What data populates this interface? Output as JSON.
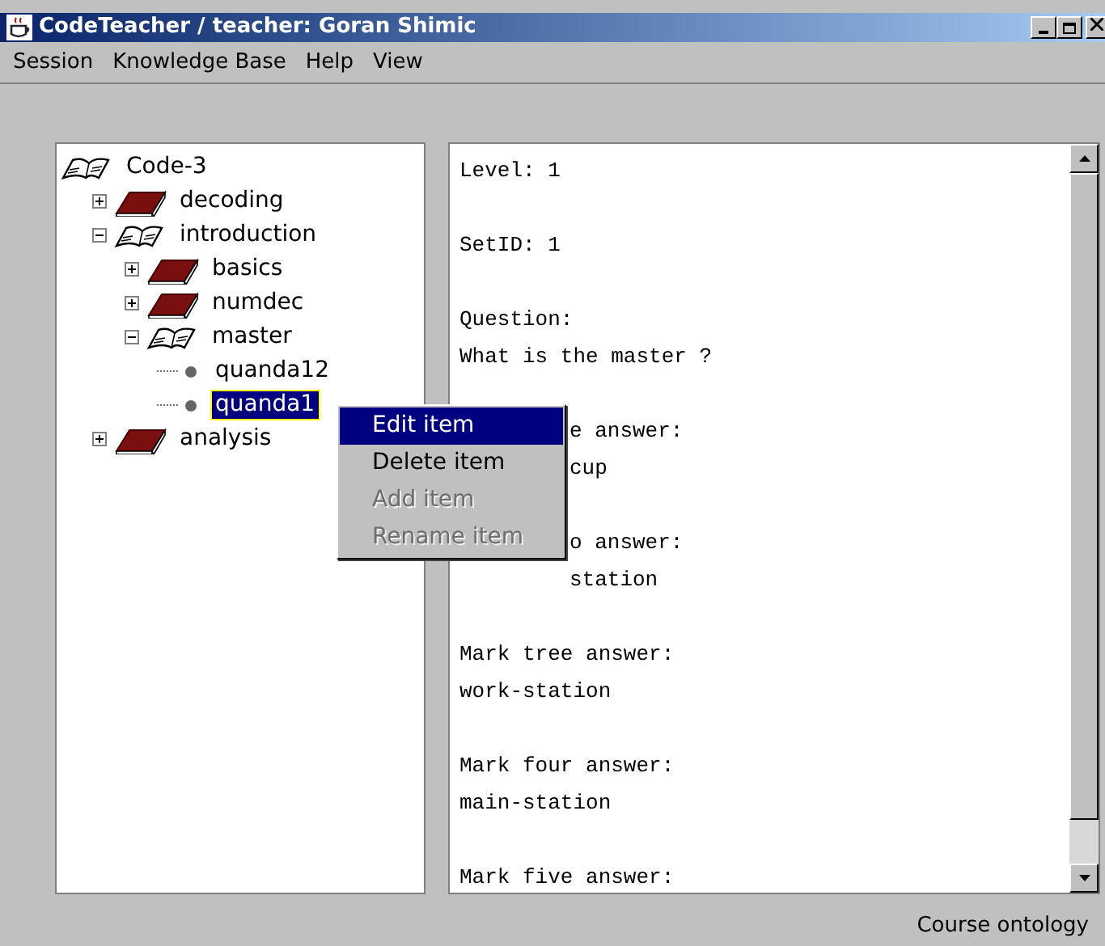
{
  "window": {
    "title": "CodeTeacher / teacher: Goran Shimic"
  },
  "menu_bar": [
    "Session",
    "Knowledge Base",
    "Help",
    "View"
  ],
  "tree": [
    {
      "label": "Code-3",
      "kind": "folder",
      "expanded": true,
      "selected": false,
      "children": [
        {
          "label": "decoding",
          "kind": "folder",
          "expanded": false,
          "selected": false
        },
        {
          "label": "introduction",
          "kind": "folder",
          "expanded": true,
          "selected": false,
          "children": [
            {
              "label": "basics",
              "kind": "folder",
              "expanded": false,
              "selected": false
            },
            {
              "label": "numdec",
              "kind": "folder",
              "expanded": false,
              "selected": false
            },
            {
              "label": "master",
              "kind": "folder",
              "expanded": true,
              "selected": false,
              "children": [
                {
                  "label": "quanda12",
                  "kind": "leaf",
                  "selected": false
                },
                {
                  "label": "quanda1",
                  "kind": "leaf",
                  "selected": true
                }
              ]
            }
          ]
        },
        {
          "label": "analysis",
          "kind": "folder",
          "expanded": false,
          "selected": false
        }
      ]
    }
  ],
  "text_lines": [
    {
      "text": "Level: 1",
      "kind": "full"
    },
    {
      "kind": "blank"
    },
    {
      "text": "SetID: 1",
      "kind": "full"
    },
    {
      "kind": "blank"
    },
    {
      "text": "Question:",
      "kind": "full"
    },
    {
      "text": "What is the master ?",
      "kind": "full"
    },
    {
      "kind": "blank"
    },
    {
      "text": "e answer:",
      "kind": "covered"
    },
    {
      "text": "cup",
      "kind": "covered"
    },
    {
      "kind": "blank"
    },
    {
      "text": "o answer:",
      "kind": "covered"
    },
    {
      "text": "station",
      "kind": "covered"
    },
    {
      "kind": "blank"
    },
    {
      "text": "Mark tree answer:",
      "kind": "full"
    },
    {
      "text": "work-station",
      "kind": "full"
    },
    {
      "kind": "blank"
    },
    {
      "text": "Mark four answer:",
      "kind": "full"
    },
    {
      "text": "main-station",
      "kind": "full"
    },
    {
      "kind": "blank"
    },
    {
      "text": "Mark five answer:",
      "kind": "full"
    }
  ],
  "context_menu": [
    {
      "label": "Edit item",
      "selected": true,
      "disabled": false
    },
    {
      "label": "Delete item",
      "selected": false,
      "disabled": false
    },
    {
      "label": "Add item",
      "selected": false,
      "disabled": true
    },
    {
      "label": "Rename item",
      "selected": false,
      "disabled": true
    }
  ],
  "status_bar": "Course ontology"
}
